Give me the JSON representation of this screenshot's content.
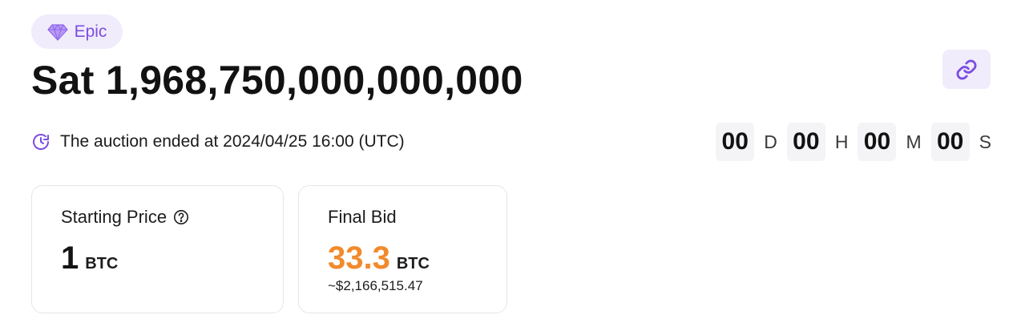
{
  "badge": {
    "label": "Epic",
    "icon": "diamond-icon",
    "accent": "#7b4ee0"
  },
  "title": "Sat 1,968,750,000,000,000",
  "actions": {
    "link_icon": "link-icon"
  },
  "auction": {
    "ended_text": "The auction ended at 2024/04/25 16:00 (UTC)",
    "icon": "clock-icon"
  },
  "countdown": [
    {
      "value": "00",
      "unit": "D"
    },
    {
      "value": "00",
      "unit": "H"
    },
    {
      "value": "00",
      "unit": "M"
    },
    {
      "value": "00",
      "unit": "S"
    }
  ],
  "starting_price": {
    "label": "Starting Price",
    "value": "1",
    "unit": "BTC",
    "help_icon": "help-icon"
  },
  "final_bid": {
    "label": "Final Bid",
    "value": "33.3",
    "unit": "BTC",
    "usd": "~$2,166,515.47",
    "color": "#f28a2c"
  }
}
